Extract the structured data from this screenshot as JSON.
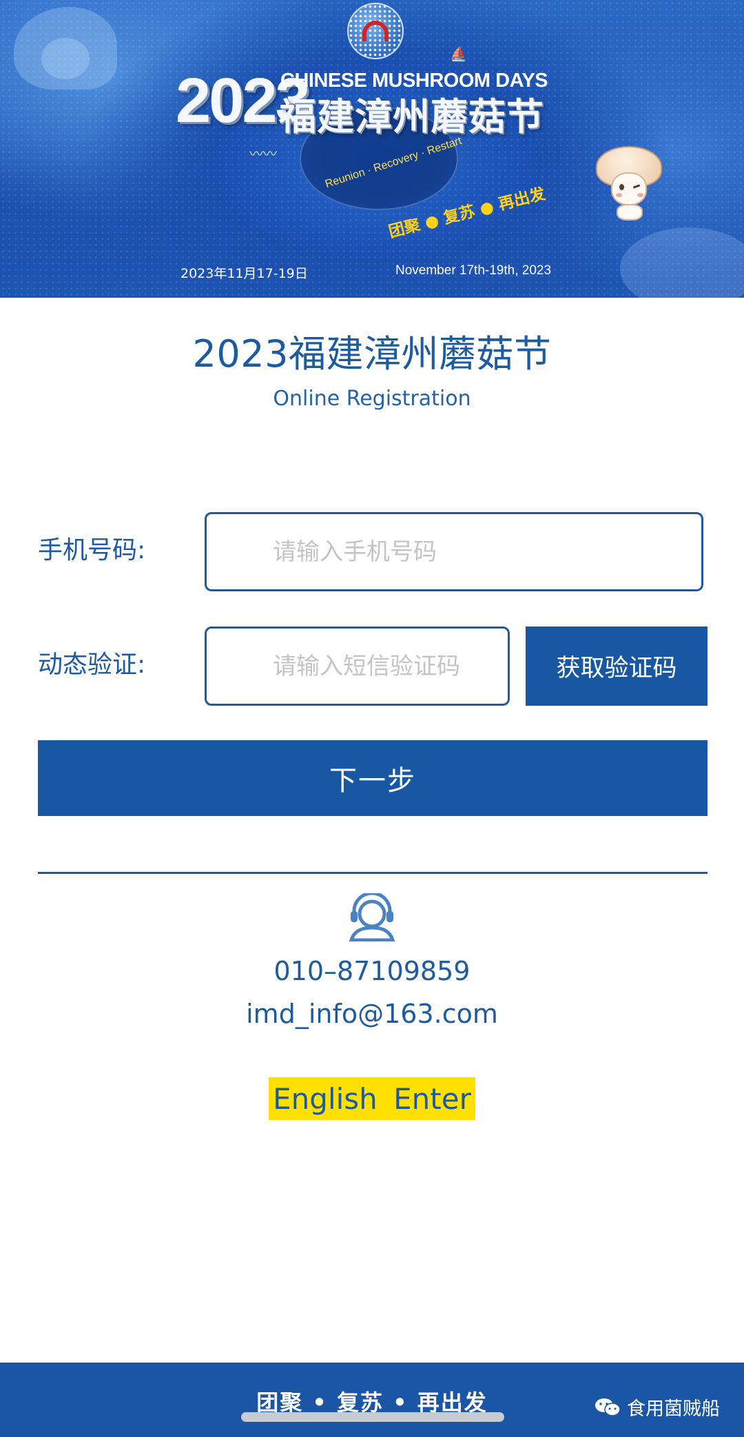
{
  "banner": {
    "year": "2023",
    "event_en": "CHINESE MUSHROOM DAYS",
    "event_cn": "福建漳州蘑菇节",
    "motto_en": "Reunion · Recovery · Restart",
    "motto_cn": "团聚 ● 复苏 ● 再出发",
    "date_cn": "2023年11月17-19日",
    "date_en": "November 17th-19th, 2023"
  },
  "header": {
    "title": "2023福建漳州蘑菇节",
    "subtitle": "Online Registration"
  },
  "form": {
    "phone_label": "手机号码:",
    "phone_placeholder": "请输入手机号码",
    "phone_value": "",
    "code_label": "动态验证:",
    "code_placeholder": "请输入短信验证码",
    "code_value": "",
    "get_code_button": "获取验证码",
    "next_button": "下一步"
  },
  "contact": {
    "icon": "customer-service-headset-icon",
    "phone": "010–87109859",
    "email": "imd_info@163.com"
  },
  "language_switch": "English  Enter",
  "footer": {
    "motto": "团聚 • 复苏 • 再出发",
    "wechat_account": "食用菌贼船"
  },
  "colors": {
    "primary": "#1858a3",
    "text_blue": "#1d5ba0",
    "highlight_yellow": "#ffe000",
    "placeholder_gray": "#c4c4c4"
  }
}
